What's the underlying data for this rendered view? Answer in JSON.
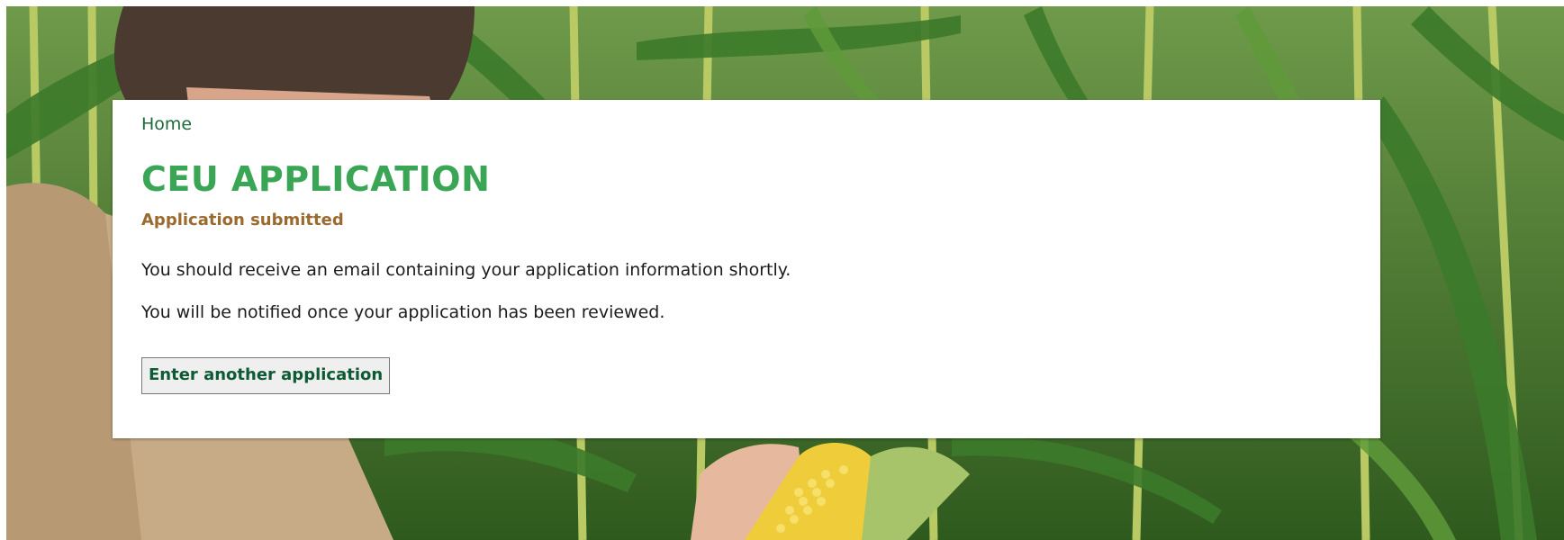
{
  "breadcrumb": {
    "home_label": "Home"
  },
  "page": {
    "title": "CEU APPLICATION",
    "status": "Application submitted",
    "messages": [
      "You should receive an email containing your application information shortly.",
      "You will be notified once your application has been reviewed."
    ],
    "action_label": "Enter another application"
  },
  "colors": {
    "title": "#3aa655",
    "status": "#9a6a2e",
    "link": "#1e6b3a",
    "button_text": "#0e5a34"
  },
  "background": {
    "image": "cornfield-with-farmer-holding-corn-cob"
  }
}
